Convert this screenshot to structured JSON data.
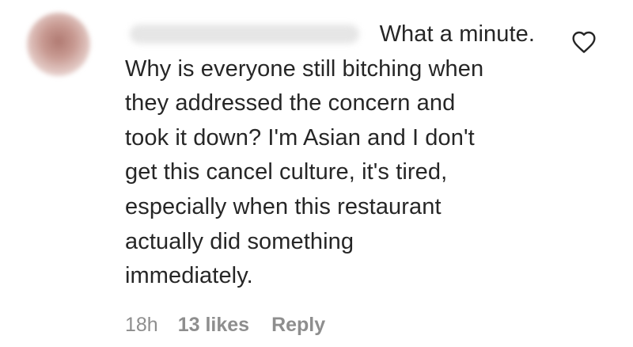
{
  "comment": {
    "username_icon": "blurred-username",
    "avatar_icon": "blurred-avatar",
    "lines": [
      "What a minute.",
      "Why is everyone still bitching when",
      "they addressed the concern and",
      "took it down? I'm Asian and I don't",
      "get this cancel culture, it's tired,",
      "especially when this restaurant",
      "actually did something",
      "immediately."
    ]
  },
  "meta": {
    "time": "18h",
    "likes": "13 likes",
    "reply": "Reply"
  },
  "icons": {
    "like": "heart-outline-icon"
  },
  "colors": {
    "text": "#262626",
    "secondary": "#8e8e8e"
  }
}
